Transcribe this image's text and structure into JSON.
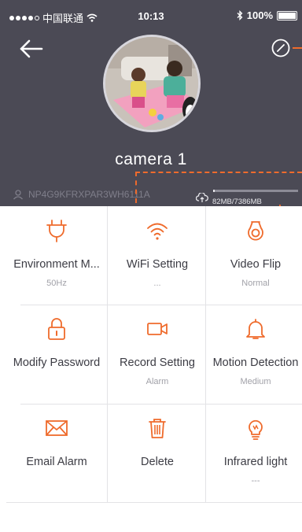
{
  "status_bar": {
    "carrier": "中国联通",
    "time": "10:13",
    "battery": "100%"
  },
  "colors": {
    "header_bg": "#4b4a55",
    "accent": "#ef6b2c",
    "divider": "#e3e3e6"
  },
  "header": {
    "back_icon": "back-arrow-icon",
    "edit_icon": "edit-icon",
    "camera_name": "camera 1",
    "device_id": "NP4G9KFRXPAR3WH6111A",
    "storage_text": "82MB/7386MB",
    "storage_fraction": 0.011
  },
  "settings": [
    {
      "icon": "plug-icon",
      "label": "Environment M...",
      "sub": "50Hz"
    },
    {
      "icon": "wifi-icon",
      "label": "WiFi Setting",
      "sub": "..."
    },
    {
      "icon": "video-flip-icon",
      "label": "Video Flip",
      "sub": "Normal"
    },
    {
      "icon": "lock-icon",
      "label": "Modify Password",
      "sub": ""
    },
    {
      "icon": "video-camera-icon",
      "label": "Record Setting",
      "sub": "Alarm"
    },
    {
      "icon": "bell-icon",
      "label": "Motion Detection",
      "sub": "Medium"
    },
    {
      "icon": "envelope-icon",
      "label": "Email Alarm",
      "sub": ""
    },
    {
      "icon": "trash-icon",
      "label": "Delete",
      "sub": ""
    },
    {
      "icon": "light-bulb-icon",
      "label": "Infrared light",
      "sub": "---"
    }
  ]
}
